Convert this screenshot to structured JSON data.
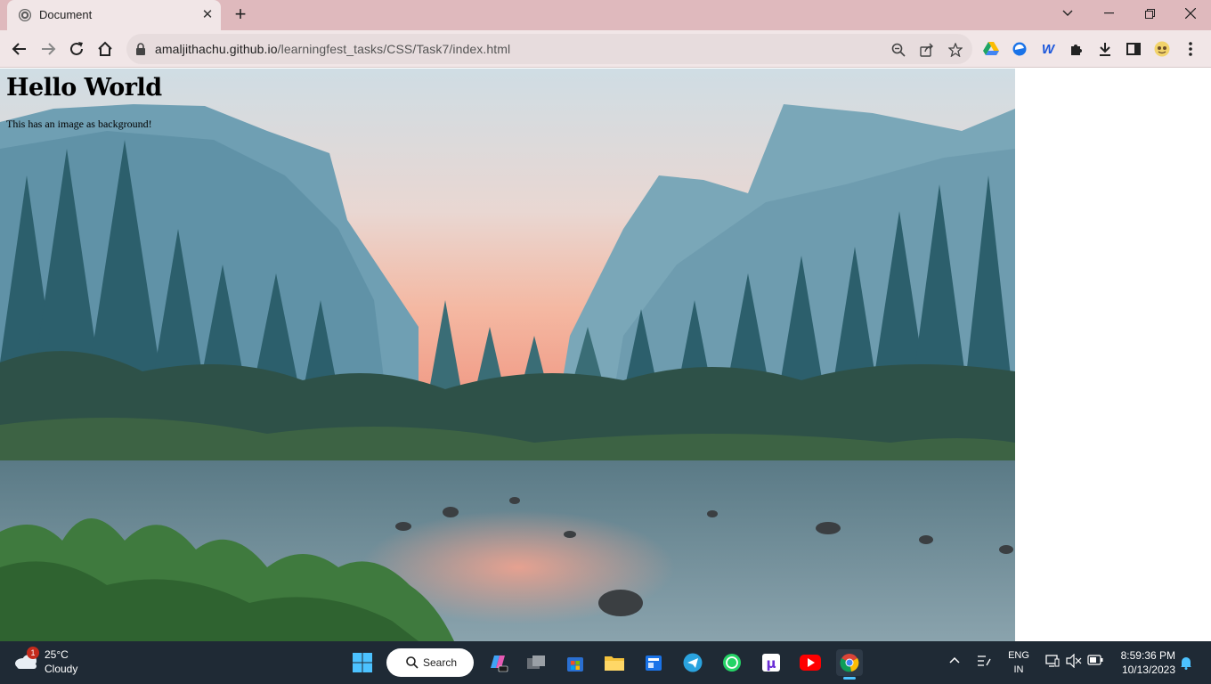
{
  "browser": {
    "tab_title": "Document",
    "url_host": "amaljithachu.github.io",
    "url_path": "/learningfest_tasks/CSS/Task7/index.html"
  },
  "page": {
    "heading": "Hello World",
    "paragraph": "This has an image as background!"
  },
  "taskbar": {
    "weather_temp": "25°C",
    "weather_condition": "Cloudy",
    "weather_badge": "1",
    "search_label": "Search",
    "language_top": "ENG",
    "language_bottom": "IN",
    "time": "8:59:36 PM",
    "date": "10/13/2023"
  },
  "colors": {
    "tabbar": "#dfb9bd",
    "toolbar": "#f1e6e7",
    "taskbar": "#1f2a35"
  }
}
